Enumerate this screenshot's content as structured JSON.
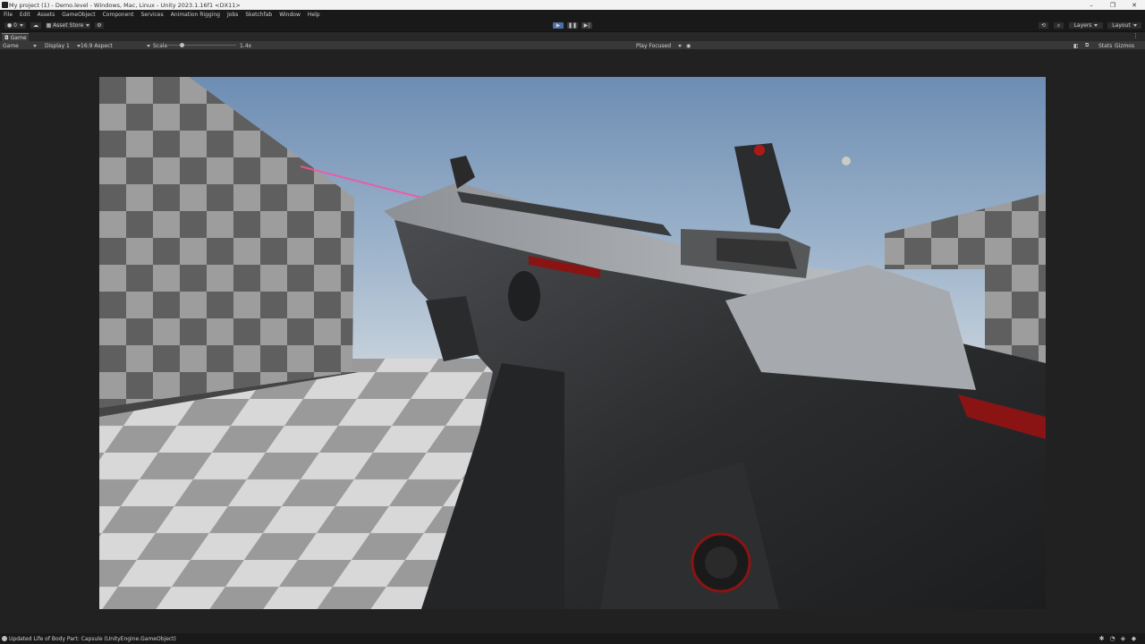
{
  "window": {
    "title": "My project (1) - Demo.level - Windows, Mac, Linux - Unity 2023.1.16f1 <DX11>"
  },
  "menu": [
    "File",
    "Edit",
    "Assets",
    "GameObject",
    "Component",
    "Services",
    "Animation Rigging",
    "Jobs",
    "Sketchfab",
    "Window",
    "Help"
  ],
  "toolbar": {
    "account_label": "0",
    "asset_store_label": "Asset Store",
    "layers_label": "Layers",
    "layout_label": "Layout"
  },
  "game_tab": {
    "label": "Game"
  },
  "game_view": {
    "mode": "Game",
    "display": "Display 1",
    "aspect": "16:9 Aspect",
    "scale_label": "Scale",
    "scale_value": "1.4x",
    "play_focused": "Play Focused",
    "stats_label": "Stats",
    "gizmos_label": "Gizmos"
  },
  "status": {
    "message": "Updated Life of Body Part: Capsule (UnityEngine.GameObject)"
  },
  "colors": {
    "accent": "#4a90e2",
    "sky_top": "#6f8fb4",
    "laser": "#ff4fa0"
  },
  "icons": [
    "unity-logo-icon",
    "cloud-icon",
    "settings-icon",
    "history-icon",
    "search-icon",
    "layers-icon",
    "play-icon",
    "pause-icon",
    "step-icon",
    "mute-icon",
    "more-icon"
  ]
}
